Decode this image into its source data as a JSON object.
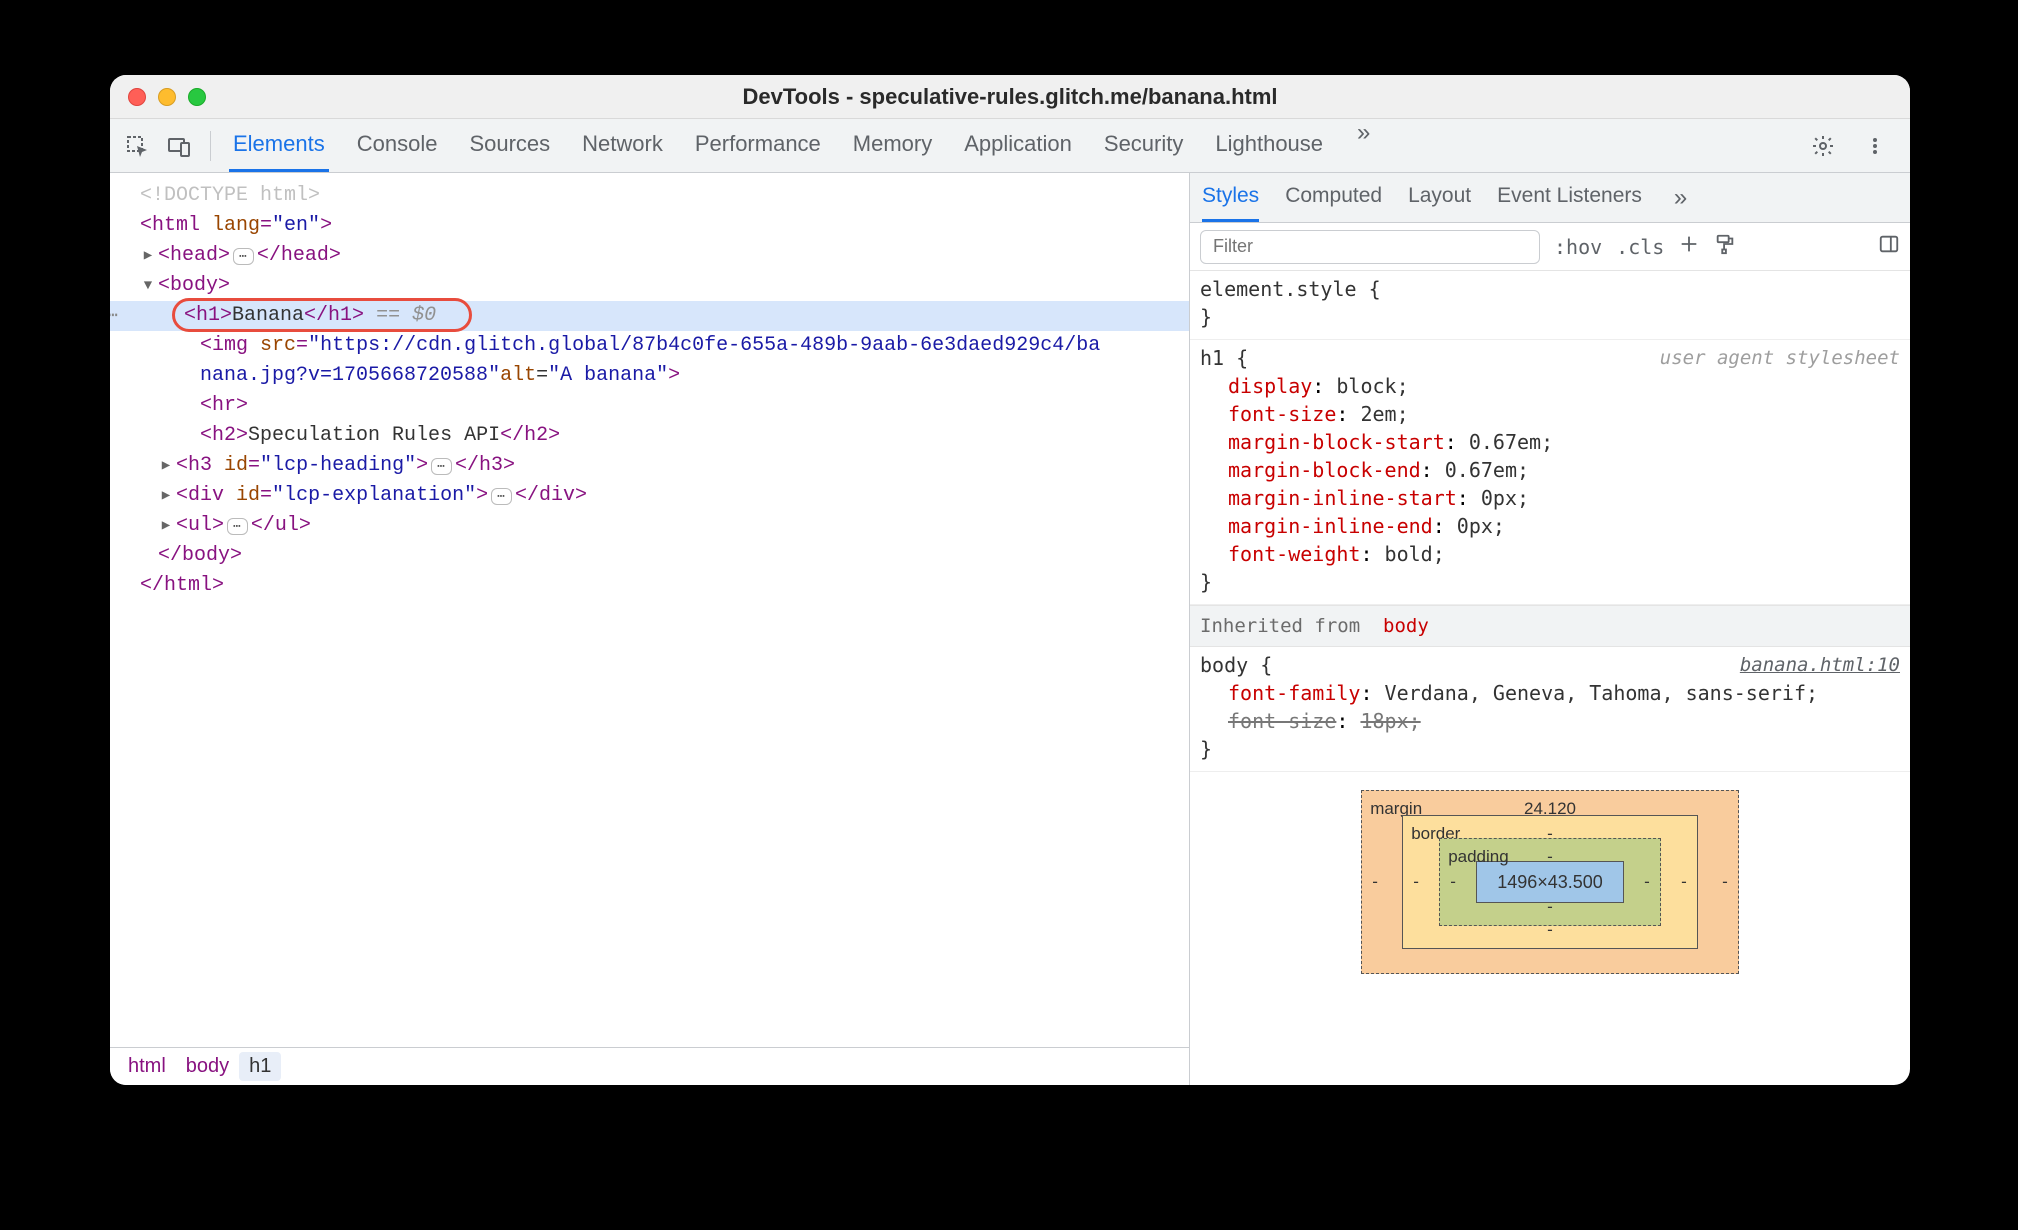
{
  "window": {
    "title": "DevTools - speculative-rules.glitch.me/banana.html"
  },
  "main_tabs": {
    "items": [
      "Elements",
      "Console",
      "Sources",
      "Network",
      "Performance",
      "Memory",
      "Application",
      "Security",
      "Lighthouse"
    ],
    "active_index": 0
  },
  "dom": {
    "doctype": "<!DOCTYPE html>",
    "html_open": "<html lang=\"en\">",
    "head_tag": "head",
    "body_open": "<body>",
    "selected": {
      "tag_open": "<h1>",
      "text": "Banana",
      "tag_close": "</h1>",
      "ref": "== $0"
    },
    "img": {
      "src_line1": "https://cdn.glitch.global/87b4c0fe-655a-489b-9aab-6e3daed929c4/ba",
      "src_line2": "nana.jpg?v=1705668720588",
      "alt": "A banana"
    },
    "hr": "<hr>",
    "h2_text": "Speculation Rules API",
    "h3_id": "lcp-heading",
    "div_id": "lcp-explanation",
    "ul_tag": "ul",
    "body_close": "</body>",
    "html_close": "</html>"
  },
  "breadcrumbs": [
    "html",
    "body",
    "h1"
  ],
  "styles_tabs": {
    "items": [
      "Styles",
      "Computed",
      "Layout",
      "Event Listeners"
    ],
    "active_index": 0
  },
  "styles_toolbar": {
    "filter_placeholder": "Filter",
    "hov": ":hov",
    "cls": ".cls"
  },
  "rules": {
    "element_style": {
      "selector": "element.style",
      "open": "{",
      "close": "}"
    },
    "h1": {
      "selector": "h1",
      "origin": "user agent stylesheet",
      "props": [
        {
          "name": "display",
          "value": "block;"
        },
        {
          "name": "font-size",
          "value": "2em;"
        },
        {
          "name": "margin-block-start",
          "value": "0.67em;"
        },
        {
          "name": "margin-block-end",
          "value": "0.67em;"
        },
        {
          "name": "margin-inline-start",
          "value": "0px;"
        },
        {
          "name": "margin-inline-end",
          "value": "0px;"
        },
        {
          "name": "font-weight",
          "value": "bold;"
        }
      ]
    },
    "inherited_label": "Inherited from",
    "inherited_from": "body",
    "body_rule": {
      "selector": "body",
      "link": "banana.html:10",
      "props": [
        {
          "name": "font-family",
          "value": "Verdana, Geneva, Tahoma, sans-serif;",
          "struck": false
        },
        {
          "name": "font-size",
          "value": "18px;",
          "struck": true
        }
      ]
    }
  },
  "boxmodel": {
    "margin_label": "margin",
    "margin_top": "24.120",
    "border_label": "border",
    "padding_label": "padding",
    "content": "1496×43.500",
    "dash": "-"
  }
}
